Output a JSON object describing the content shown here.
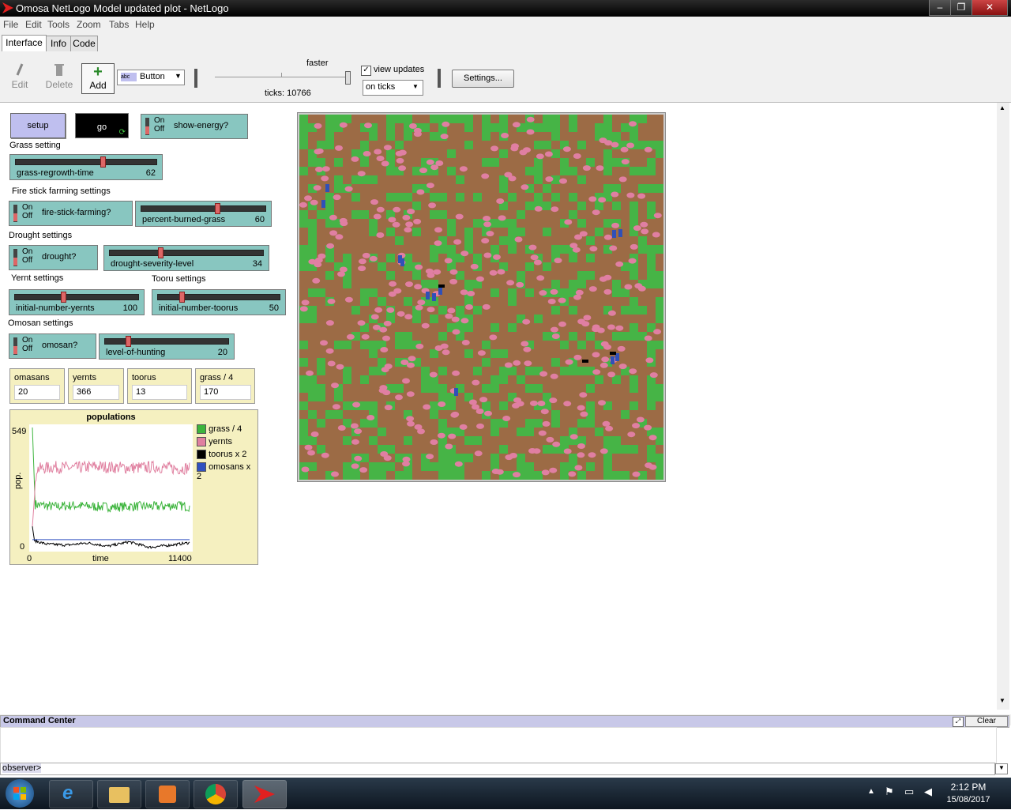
{
  "window": {
    "title": "Omosa NetLogo Model updated plot - NetLogo"
  },
  "menu": [
    "File",
    "Edit",
    "Tools",
    "Zoom",
    "Tabs",
    "Help"
  ],
  "tabs": [
    "Interface",
    "Info",
    "Code"
  ],
  "toolbar": {
    "edit": "Edit",
    "delete": "Delete",
    "add": "Add",
    "widget_type": "Button",
    "speed_label": "faster",
    "ticks": "ticks: 10766",
    "view_updates": "view updates",
    "update_mode": "on ticks",
    "settings": "Settings..."
  },
  "widgets": {
    "setup": "setup",
    "go": "go",
    "show_energy": "show-energy?",
    "on": "On",
    "off": "Off",
    "grass_setting": "Grass setting",
    "grass_regrowth": {
      "label": "grass-regrowth-time",
      "value": "62"
    },
    "fire_settings": "Fire stick farming settings",
    "fire_stick": "fire-stick-farming?",
    "percent_burned": {
      "label": "percent-burned-grass",
      "value": "60"
    },
    "drought_settings": "Drought settings",
    "drought": "drought?",
    "drought_severity": {
      "label": "drought-severity-level",
      "value": "34"
    },
    "yernt_settings": "Yernt settings",
    "tooru_settings": "Tooru settings",
    "init_yernts": {
      "label": "initial-number-yernts",
      "value": "100"
    },
    "init_toorus": {
      "label": "initial-number-toorus",
      "value": "50"
    },
    "omosan_settings": "Omosan settings",
    "omosan": "omosan?",
    "level_hunting": {
      "label": "level-of-hunting",
      "value": "20"
    },
    "monitors": [
      {
        "label": "omasans",
        "value": "20"
      },
      {
        "label": "yernts",
        "value": "366"
      },
      {
        "label": "toorus",
        "value": "13"
      },
      {
        "label": "grass / 4",
        "value": "170"
      }
    ]
  },
  "plot": {
    "title": "populations",
    "ylabel": "pop.",
    "xlabel": "time",
    "ymax_label": "549",
    "ymin_label": "0",
    "xmin_label": "0",
    "xmax_label": "11400"
  },
  "chart_data": {
    "type": "line",
    "title": "populations",
    "xlabel": "time",
    "ylabel": "pop.",
    "xlim": [
      0,
      11400
    ],
    "ylim": [
      0,
      549
    ],
    "series": [
      {
        "name": "grass / 4",
        "color": "#3cb43c",
        "x": [
          0,
          200,
          1500,
          3000,
          4500,
          6000,
          7500,
          9000,
          10500,
          11400
        ],
        "values": [
          549,
          200,
          190,
          195,
          190,
          188,
          192,
          190,
          195,
          190
        ]
      },
      {
        "name": "yernts",
        "color": "#e080a0",
        "x": [
          0,
          300,
          1500,
          3000,
          4500,
          6000,
          7500,
          9000,
          10500,
          11400
        ],
        "values": [
          100,
          360,
          370,
          365,
          372,
          368,
          366,
          370,
          362,
          366
        ]
      },
      {
        "name": "toorus x 2",
        "color": "#000000",
        "x": [
          0,
          150,
          1000,
          2500,
          4000,
          5500,
          7000,
          8500,
          10000,
          11400
        ],
        "values": [
          100,
          35,
          20,
          15,
          25,
          10,
          30,
          5,
          15,
          26
        ]
      },
      {
        "name": "omosans x 2",
        "color": "#3050c0",
        "x": [
          0,
          11400
        ],
        "values": [
          40,
          40
        ]
      }
    ]
  },
  "view": {
    "grass_color": "#46b446",
    "dirt_color": "#9c6b45",
    "yernt_color": "#e07fa2",
    "omosan_color": "#3050b8"
  },
  "command_center": {
    "title": "Command Center",
    "clear": "Clear",
    "prompt": "observer>"
  },
  "taskbar": {
    "time": "2:12 PM",
    "date": "15/08/2017"
  }
}
